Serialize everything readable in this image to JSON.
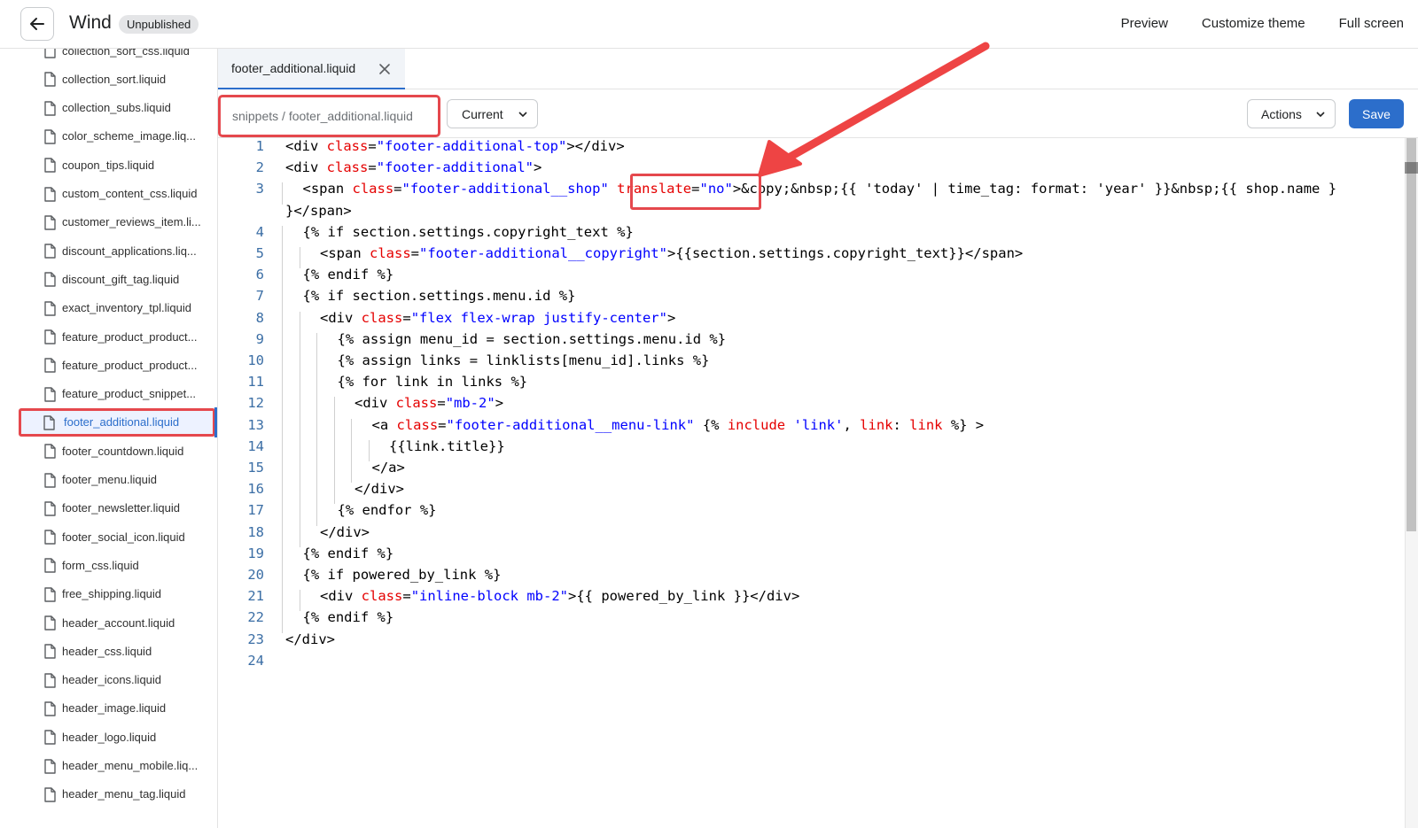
{
  "header": {
    "theme_name": "Wind",
    "status": "Unpublished",
    "links": [
      "Preview",
      "Customize theme",
      "Full screen"
    ]
  },
  "sidebar": {
    "files": [
      "collection_sort_css.liquid",
      "collection_sort.liquid",
      "collection_subs.liquid",
      "color_scheme_image.liq...",
      "coupon_tips.liquid",
      "custom_content_css.liquid",
      "customer_reviews_item.li...",
      "discount_applications.liq...",
      "discount_gift_tag.liquid",
      "exact_inventory_tpl.liquid",
      "feature_product_product...",
      "feature_product_product...",
      "feature_product_snippet...",
      "footer_additional.liquid",
      "footer_countdown.liquid",
      "footer_menu.liquid",
      "footer_newsletter.liquid",
      "footer_social_icon.liquid",
      "form_css.liquid",
      "free_shipping.liquid",
      "header_account.liquid",
      "header_css.liquid",
      "header_icons.liquid",
      "header_image.liquid",
      "header_logo.liquid",
      "header_menu_mobile.liq...",
      "header_menu_tag.liquid"
    ],
    "active_index": 13
  },
  "tab": {
    "label": "footer_additional.liquid"
  },
  "toolbar": {
    "path": "snippets / footer_additional.liquid",
    "version": "Current",
    "actions_label": "Actions",
    "save_label": "Save"
  },
  "colors": {
    "accent": "#2c6ecb",
    "highlight": "#e5484d",
    "attr": "#e50000",
    "string": "#0000ff"
  },
  "code_lines": [
    {
      "n": "1",
      "indent": 0,
      "tokens": [
        [
          "t",
          "<div "
        ],
        [
          "a",
          "class"
        ],
        [
          "t",
          "="
        ],
        [
          "s",
          "\"footer-additional-top\""
        ],
        [
          "t",
          "></div>"
        ]
      ]
    },
    {
      "n": "2",
      "indent": 0,
      "tokens": [
        [
          "t",
          "<div "
        ],
        [
          "a",
          "class"
        ],
        [
          "t",
          "="
        ],
        [
          "s",
          "\"footer-additional\""
        ],
        [
          "t",
          ">"
        ]
      ]
    },
    {
      "n": "3",
      "indent": 1,
      "tokens": [
        [
          "t",
          "<span "
        ],
        [
          "a",
          "class"
        ],
        [
          "t",
          "="
        ],
        [
          "s",
          "\"footer-additional__shop\""
        ],
        [
          "t",
          " "
        ],
        [
          "a",
          "translate"
        ],
        [
          "t",
          "="
        ],
        [
          "s",
          "\"no\""
        ],
        [
          "t",
          ">&copy;&nbsp;{{ 'today' | time_tag: format: 'year' }}&nbsp;{{ shop.name }"
        ]
      ]
    },
    {
      "n": "",
      "indent": 0,
      "tokens": [
        [
          "t",
          "}</span>"
        ]
      ]
    },
    {
      "n": "4",
      "indent": 1,
      "tokens": [
        [
          "t",
          "{% if section.settings.copyright_text %}"
        ]
      ]
    },
    {
      "n": "5",
      "indent": 2,
      "tokens": [
        [
          "t",
          "<span "
        ],
        [
          "a",
          "class"
        ],
        [
          "t",
          "="
        ],
        [
          "s",
          "\"footer-additional__copyright\""
        ],
        [
          "t",
          ">{{section.settings.copyright_text}}</span>"
        ]
      ]
    },
    {
      "n": "6",
      "indent": 1,
      "tokens": [
        [
          "t",
          "{% endif %}"
        ]
      ]
    },
    {
      "n": "7",
      "indent": 1,
      "tokens": [
        [
          "t",
          "{% if section.settings.menu.id %}"
        ]
      ]
    },
    {
      "n": "8",
      "indent": 2,
      "tokens": [
        [
          "t",
          "<div "
        ],
        [
          "a",
          "class"
        ],
        [
          "t",
          "="
        ],
        [
          "s",
          "\"flex flex-wrap justify-center\""
        ],
        [
          "t",
          ">"
        ]
      ]
    },
    {
      "n": "9",
      "indent": 3,
      "tokens": [
        [
          "t",
          "{% assign menu_id = section.settings.menu.id %}"
        ]
      ]
    },
    {
      "n": "10",
      "indent": 3,
      "tokens": [
        [
          "t",
          "{% assign links = linklists[menu_id].links %}"
        ]
      ]
    },
    {
      "n": "11",
      "indent": 3,
      "tokens": [
        [
          "t",
          "{% for link in links %}"
        ]
      ]
    },
    {
      "n": "12",
      "indent": 4,
      "tokens": [
        [
          "t",
          "<div "
        ],
        [
          "a",
          "class"
        ],
        [
          "t",
          "="
        ],
        [
          "s",
          "\"mb-2\""
        ],
        [
          "t",
          ">"
        ]
      ]
    },
    {
      "n": "13",
      "indent": 5,
      "tokens": [
        [
          "t",
          "<a "
        ],
        [
          "a",
          "class"
        ],
        [
          "t",
          "="
        ],
        [
          "s",
          "\"footer-additional__menu-link\""
        ],
        [
          "t",
          " {% "
        ],
        [
          "a",
          "include"
        ],
        [
          "t",
          " "
        ],
        [
          "s",
          "'link'"
        ],
        [
          "t",
          ", "
        ],
        [
          "a",
          "link"
        ],
        [
          "t",
          ": "
        ],
        [
          "a",
          "link"
        ],
        [
          "t",
          " %} >"
        ]
      ]
    },
    {
      "n": "14",
      "indent": 6,
      "tokens": [
        [
          "t",
          "{{link.title}}"
        ]
      ]
    },
    {
      "n": "15",
      "indent": 5,
      "tokens": [
        [
          "t",
          "</a>"
        ]
      ]
    },
    {
      "n": "16",
      "indent": 4,
      "tokens": [
        [
          "t",
          "</div>"
        ]
      ]
    },
    {
      "n": "17",
      "indent": 3,
      "tokens": [
        [
          "t",
          "{% endfor %}"
        ]
      ]
    },
    {
      "n": "18",
      "indent": 2,
      "tokens": [
        [
          "t",
          "</div>"
        ]
      ]
    },
    {
      "n": "19",
      "indent": 1,
      "tokens": [
        [
          "t",
          "{% endif %}"
        ]
      ]
    },
    {
      "n": "20",
      "indent": 1,
      "tokens": [
        [
          "t",
          "{% if powered_by_link %}"
        ]
      ]
    },
    {
      "n": "21",
      "indent": 2,
      "tokens": [
        [
          "t",
          "<div "
        ],
        [
          "a",
          "class"
        ],
        [
          "t",
          "="
        ],
        [
          "s",
          "\"inline-block mb-2\""
        ],
        [
          "t",
          ">{{ powered_by_link }}</div>"
        ]
      ]
    },
    {
      "n": "22",
      "indent": 1,
      "tokens": [
        [
          "t",
          "{% endif %}"
        ]
      ]
    },
    {
      "n": "23",
      "indent": 0,
      "tokens": [
        [
          "t",
          "</div>"
        ]
      ]
    },
    {
      "n": "24",
      "indent": 0,
      "tokens": []
    }
  ]
}
